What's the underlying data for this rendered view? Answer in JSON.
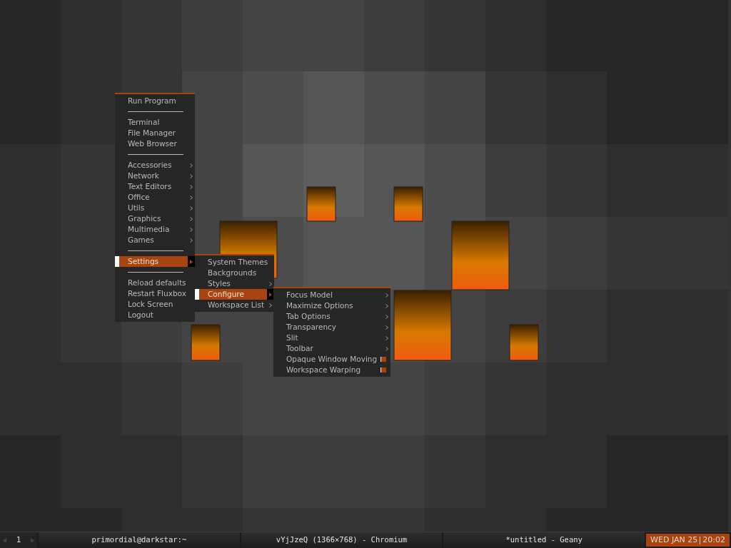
{
  "menus": [
    {
      "items": [
        {
          "kind": "item",
          "label": "Run Program"
        },
        {
          "kind": "separator"
        },
        {
          "kind": "item",
          "label": "Terminal"
        },
        {
          "kind": "item",
          "label": "File Manager"
        },
        {
          "kind": "item",
          "label": "Web Browser"
        },
        {
          "kind": "separator"
        },
        {
          "kind": "submenu",
          "label": "Accessories",
          "selected": false
        },
        {
          "kind": "submenu",
          "label": "Network",
          "selected": false
        },
        {
          "kind": "submenu",
          "label": "Text Editors",
          "selected": false
        },
        {
          "kind": "submenu",
          "label": "Office",
          "selected": false
        },
        {
          "kind": "submenu",
          "label": "Utils",
          "selected": false
        },
        {
          "kind": "submenu",
          "label": "Graphics",
          "selected": false
        },
        {
          "kind": "submenu",
          "label": "Multimedia",
          "selected": false
        },
        {
          "kind": "submenu",
          "label": "Games",
          "selected": false
        },
        {
          "kind": "separator"
        },
        {
          "kind": "submenu",
          "label": "Settings",
          "selected": true
        },
        {
          "kind": "separator"
        },
        {
          "kind": "item",
          "label": "Reload defaults"
        },
        {
          "kind": "item",
          "label": "Restart Fluxbox"
        },
        {
          "kind": "item",
          "label": "Lock Screen"
        },
        {
          "kind": "item",
          "label": "Logout"
        }
      ]
    },
    {
      "items": [
        {
          "kind": "item",
          "label": "System Themes"
        },
        {
          "kind": "item",
          "label": "Backgrounds"
        },
        {
          "kind": "submenu",
          "label": "Styles",
          "selected": false
        },
        {
          "kind": "submenu",
          "label": "Configure",
          "selected": true
        },
        {
          "kind": "submenu",
          "label": "Workspace List",
          "selected": false
        }
      ]
    },
    {
      "items": [
        {
          "kind": "submenu",
          "label": "Focus Model",
          "selected": false
        },
        {
          "kind": "submenu",
          "label": "Maximize Options",
          "selected": false
        },
        {
          "kind": "submenu",
          "label": "Tab Options",
          "selected": false
        },
        {
          "kind": "submenu",
          "label": "Transparency",
          "selected": false
        },
        {
          "kind": "submenu",
          "label": "Slit",
          "selected": false
        },
        {
          "kind": "submenu",
          "label": "Toolbar",
          "selected": false
        },
        {
          "kind": "toggle",
          "label": "Opaque Window Moving",
          "checked": true
        },
        {
          "kind": "toggle",
          "label": "Workspace Warping",
          "checked": true
        }
      ]
    }
  ],
  "taskbar": {
    "workspace": "1",
    "tasks": [
      "primordial@darkstar:~",
      "vYjJzeQ (1366×768) - Chromium",
      "*untitled - Geany"
    ],
    "clock": {
      "date": "WED JAN 25",
      "time": "20:02"
    }
  }
}
